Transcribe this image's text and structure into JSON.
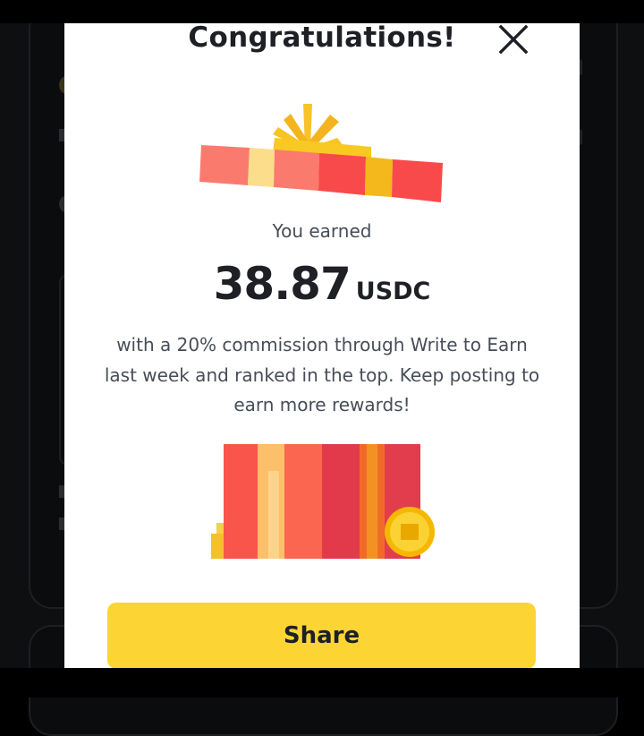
{
  "modal": {
    "title": "Congratulations!",
    "earned_label": "You earned",
    "amount": "38.87",
    "unit": "USDC",
    "message": "with a 20% commission through Write to Earn last week and ranked in the top. Keep posting to earn more rewards!",
    "share_label": "Share"
  },
  "icons": {
    "close": "close-icon",
    "gift_lid": "gift-lid-illustration",
    "gift_box": "gift-box-illustration",
    "coin": "coin-icon"
  },
  "colors": {
    "accent": "#fcd535",
    "text_primary": "#1e2026",
    "text_secondary": "#474d57",
    "ribbon_red": "#f84a4a",
    "ribbon_pink": "#fb7a6e",
    "gold": "#f5b81c"
  }
}
